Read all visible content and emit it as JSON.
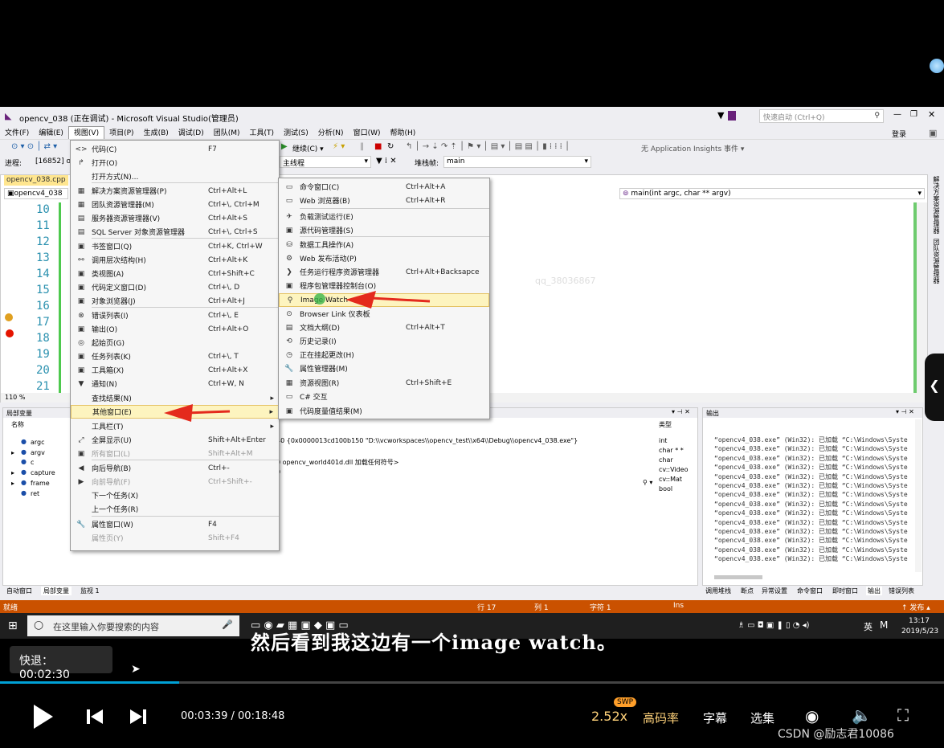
{
  "window": {
    "title": "opencv_038 (正在调试) - Microsoft Visual Studio(管理员)",
    "quick_launch": "快速启动 (Ctrl+Q)",
    "login": "登录"
  },
  "menubar": [
    "文件(F)",
    "编辑(E)",
    "视图(V)",
    "项目(P)",
    "生成(B)",
    "调试(D)",
    "团队(M)",
    "工具(T)",
    "测试(S)",
    "分析(N)",
    "窗口(W)",
    "帮助(H)"
  ],
  "toolbar": {
    "continue": "继续(C) ▾",
    "insights": "无 Application Insights 事件 ▾",
    "process_label": "进程:",
    "process_value": "[16852] o",
    "thread_label": "主线程",
    "stack_label": "堆栈帧:",
    "stack_value": "main"
  },
  "editor": {
    "file_tab": "opencv_038.cpp",
    "scope": "opencv4_038",
    "func": "main(int argc, char ** argv)",
    "zoom": "110 %",
    "lines": [
      "10",
      "11",
      "12",
      "13",
      "14",
      "15",
      "16",
      "17",
      "18",
      "19",
      "20",
      "21"
    ],
    "watermark": "qq_38036867"
  },
  "view_menu": [
    {
      "icon": "<>",
      "label": "代码(C)",
      "shortcut": "F7"
    },
    {
      "icon": "↱",
      "label": "打开(O)",
      "shortcut": ""
    },
    {
      "icon": "",
      "label": "打开方式(N)...",
      "shortcut": ""
    },
    {
      "icon": "▦",
      "label": "解决方案资源管理器(P)",
      "shortcut": "Ctrl+Alt+L"
    },
    {
      "icon": "▦",
      "label": "团队资源管理器(M)",
      "shortcut": "Ctrl+\\, Ctrl+M"
    },
    {
      "icon": "▤",
      "label": "服务器资源管理器(V)",
      "shortcut": "Ctrl+Alt+S"
    },
    {
      "icon": "▤",
      "label": "SQL Server 对象资源管理器",
      "shortcut": "Ctrl+\\, Ctrl+S"
    },
    {
      "icon": "▣",
      "label": "书签窗口(Q)",
      "shortcut": "Ctrl+K, Ctrl+W"
    },
    {
      "icon": "⚯",
      "label": "调用层次结构(H)",
      "shortcut": "Ctrl+Alt+K"
    },
    {
      "icon": "▣",
      "label": "类视图(A)",
      "shortcut": "Ctrl+Shift+C"
    },
    {
      "icon": "▣",
      "label": "代码定义窗口(D)",
      "shortcut": "Ctrl+\\, D"
    },
    {
      "icon": "▣",
      "label": "对象浏览器(J)",
      "shortcut": "Ctrl+Alt+J"
    },
    {
      "icon": "⊗",
      "label": "错误列表(I)",
      "shortcut": "Ctrl+\\, E"
    },
    {
      "icon": "▣",
      "label": "输出(O)",
      "shortcut": "Ctrl+Alt+O"
    },
    {
      "icon": "◎",
      "label": "起始页(G)",
      "shortcut": ""
    },
    {
      "icon": "▣",
      "label": "任务列表(K)",
      "shortcut": "Ctrl+\\, T"
    },
    {
      "icon": "▣",
      "label": "工具箱(X)",
      "shortcut": "Ctrl+Alt+X"
    },
    {
      "icon": "▼",
      "label": "通知(N)",
      "shortcut": "Ctrl+W, N"
    },
    {
      "icon": "",
      "label": "查找结果(N)",
      "shortcut": "▸"
    },
    {
      "icon": "",
      "label": "其他窗口(E)",
      "shortcut": "▸"
    },
    {
      "icon": "",
      "label": "工具栏(T)",
      "shortcut": "▸"
    },
    {
      "icon": "⤢",
      "label": "全屏显示(U)",
      "shortcut": "Shift+Alt+Enter"
    },
    {
      "icon": "▣",
      "label": "所有窗口(L)",
      "shortcut": "Shift+Alt+M"
    },
    {
      "icon": "◀",
      "label": "向后导航(B)",
      "shortcut": "Ctrl+-"
    },
    {
      "icon": "▶",
      "label": "向前导航(F)",
      "shortcut": "Ctrl+Shift+-"
    },
    {
      "icon": "",
      "label": "下一个任务(X)",
      "shortcut": ""
    },
    {
      "icon": "",
      "label": "上一个任务(R)",
      "shortcut": ""
    },
    {
      "icon": "🔧",
      "label": "属性窗口(W)",
      "shortcut": "F4"
    },
    {
      "icon": "",
      "label": "属性页(Y)",
      "shortcut": "Shift+F4"
    }
  ],
  "other_windows_menu": [
    {
      "icon": "▭",
      "label": "命令窗口(C)",
      "shortcut": "Ctrl+Alt+A"
    },
    {
      "icon": "▭",
      "label": "Web 浏览器(B)",
      "shortcut": "Ctrl+Alt+R"
    },
    {
      "icon": "✈",
      "label": "负载测试运行(E)",
      "shortcut": ""
    },
    {
      "icon": "▣",
      "label": "源代码管理器(S)",
      "shortcut": ""
    },
    {
      "icon": "⛁",
      "label": "数据工具操作(A)",
      "shortcut": ""
    },
    {
      "icon": "⚙",
      "label": "Web 发布活动(P)",
      "shortcut": ""
    },
    {
      "icon": "❯",
      "label": "任务运行程序资源管理器",
      "shortcut": "Ctrl+Alt+Backsapce"
    },
    {
      "icon": "▣",
      "label": "程序包管理器控制台(O)",
      "shortcut": ""
    },
    {
      "icon": "⚲",
      "label": "Image Watch",
      "shortcut": ""
    },
    {
      "icon": "⊙",
      "label": "Browser Link 仪表板",
      "shortcut": ""
    },
    {
      "icon": "▤",
      "label": "文档大纲(D)",
      "shortcut": "Ctrl+Alt+T"
    },
    {
      "icon": "⟲",
      "label": "历史记录(I)",
      "shortcut": ""
    },
    {
      "icon": "◷",
      "label": "正在挂起更改(H)",
      "shortcut": ""
    },
    {
      "icon": "🔧",
      "label": "属性管理器(M)",
      "shortcut": ""
    },
    {
      "icon": "▦",
      "label": "资源视图(R)",
      "shortcut": "Ctrl+Shift+E"
    },
    {
      "icon": "▭",
      "label": "C# 交互",
      "shortcut": ""
    },
    {
      "icon": "▣",
      "label": "代码度量值结果(M)",
      "shortcut": ""
    }
  ],
  "locals": {
    "title": "局部变量",
    "col_name": "名称",
    "col_type": "类型",
    "vars": [
      "argc",
      "argv",
      "c",
      "capture",
      "frame",
      "ret"
    ],
    "types": [
      "int",
      "char * *",
      "char",
      "cv::Video",
      "cv::Mat",
      "bool"
    ],
    "values": [
      "40 {0x0000013cd100b150 \"D:\\\\vcworkspaces\\\\opencv_test\\\\x64\\\\Debug\\\\opencv4_038.exe\"}",
      "",
      "0 opencv_world401d.dll 加载任何符号>",
      "0"
    ],
    "tabs": [
      "自动窗口",
      "局部变量",
      "监视 1"
    ]
  },
  "output": {
    "title": "输出",
    "lines": [
      "“opencv4_038.exe” (Win32): 已加载 “C:\\Windows\\Syste",
      "“opencv4_038.exe” (Win32): 已加载 “C:\\Windows\\Syste",
      "“opencv4_038.exe” (Win32): 已加载 “C:\\Windows\\Syste",
      "“opencv4_038.exe” (Win32): 已加载 “C:\\Windows\\Syste",
      "“opencv4_038.exe” (Win32): 已加载 “C:\\Windows\\Syste",
      "“opencv4_038.exe” (Win32): 已加载 “C:\\Windows\\Syste",
      "“opencv4_038.exe” (Win32): 已加载 “C:\\Windows\\Syste",
      "“opencv4_038.exe” (Win32): 已加载 “C:\\Windows\\Syste",
      "“opencv4_038.exe” (Win32): 已加载 “C:\\Windows\\Syste",
      "“opencv4_038.exe” (Win32): 已加载 “C:\\Windows\\Syste",
      "“opencv4_038.exe” (Win32): 已加载 “C:\\Windows\\Syste",
      "“opencv4_038.exe” (Win32): 已加载 “C:\\Windows\\Syste",
      "“opencv4_038.exe” (Win32): 已加载 “C:\\Windows\\Syste",
      "“opencv4_038.exe” (Win32): 已加载 “C:\\Windows\\Syste"
    ],
    "tabs": [
      "调用堆栈",
      "断点",
      "异常设置",
      "命令窗口",
      "即时窗口",
      "输出",
      "错误列表"
    ]
  },
  "side_tabs": [
    "解决方案资源管理器",
    "团队资源管理器"
  ],
  "statusbar": {
    "ready": "就绪",
    "row": "行 17",
    "col": "列 1",
    "char": "字符 1",
    "ins": "Ins",
    "publish": "↑ 发布 ▴"
  },
  "taskbar": {
    "search_placeholder": "在这里输入你要搜索的内容",
    "time": "13:17",
    "date": "2019/5/23",
    "lang": "英"
  },
  "subtitle": "然后看到我这边有一个image watch。",
  "player": {
    "fast_back": "快退：00:02:30",
    "time": "00:03:39 / 00:18:48",
    "speed": "2.52x",
    "swp": "SWP",
    "quality": "高码率",
    "caption": "字幕",
    "select": "选集",
    "progress": 0.19,
    "watermark": "CSDN @励志君10086"
  }
}
